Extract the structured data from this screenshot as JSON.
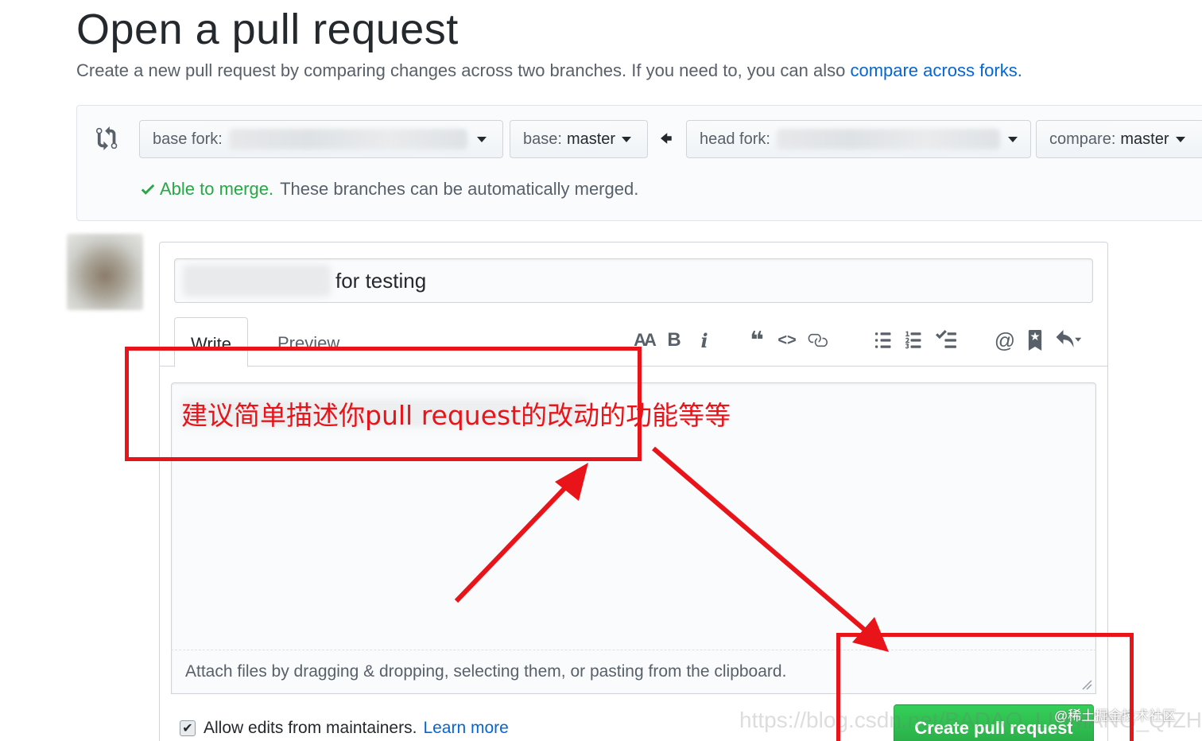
{
  "page": {
    "title": "Open a pull request",
    "subtitle_prefix": "Create a new pull request by comparing changes across two branches. If you need to, you can also ",
    "subtitle_link": "compare across forks."
  },
  "range": {
    "base_fork_label": "base fork:",
    "base_label": "base:",
    "base_branch": "master",
    "head_fork_label": "head fork:",
    "compare_label": "compare:",
    "compare_branch": "master",
    "merge_ok": "Able to merge.",
    "merge_text": " These branches can be automatically merged."
  },
  "form": {
    "title_value": "for testing",
    "tabs": [
      {
        "label": "Write"
      },
      {
        "label": "Preview"
      }
    ],
    "attach_hint": "Attach files by dragging & dropping, selecting them, or pasting from the clipboard.",
    "allow_edits": "Allow edits from maintainers.",
    "learn_more": "Learn more",
    "submit_label": "Create pull request"
  },
  "toolbar": {
    "header": "AA",
    "bold": "B",
    "italic": "i",
    "quote": "❝",
    "code": "<>",
    "mention": "@"
  },
  "annotation": {
    "text": "建议简单描述你pull request的改动的功能等等",
    "color": "#e8141a"
  },
  "watermark": {
    "csdn": "https://blog.csdn.net/BADAO_LIUMANG_QIZHI",
    "juejin": "@稀土掘金技术社区"
  }
}
